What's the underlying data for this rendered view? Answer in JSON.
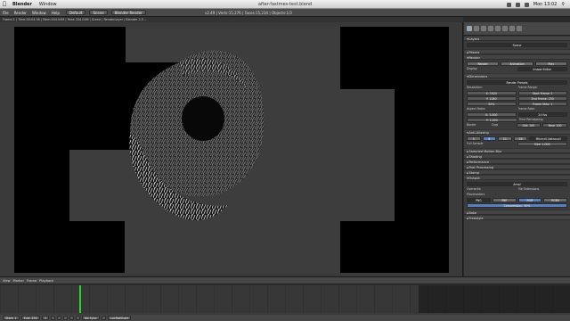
{
  "mac_menu": {
    "apple": "",
    "app": "Blender",
    "items": [
      "Window"
    ],
    "window_title": "after-fastmes-test.blend",
    "clock": "Mon 13:02"
  },
  "blender_header": {
    "menus": [
      "File",
      "Render",
      "Window",
      "Help"
    ],
    "screen_layout": "Default",
    "scene": "Scene",
    "engine": "Blender Render",
    "info": "v2.49 | Verts:15,376 | Faces:15,234 | Objects:1/3"
  },
  "render_info": "Frame:1 | Time:00:04.58 | Mem:204.04M | Peak 204.04M | Scene | RenderLayer | Blender 2.5 ...",
  "properties": {
    "layers_panel": "Layers",
    "layers_value": "Scene",
    "passes_panel": "Passes",
    "render_panel": "Render",
    "render_buttons": [
      "Render",
      "Animation",
      "Play"
    ],
    "display_label": "Display",
    "display_value": "Image Editor",
    "dimensions_panel": "Dimensions",
    "preset": "Render Presets",
    "resolution_label": "Resolution:",
    "frame_range_label": "Frame Range:",
    "res_x": "X: 1920",
    "res_y": "Y: 1080",
    "res_pct": "50%",
    "start_frame": "Start Frame: 1",
    "end_frame": "End Frame: 250",
    "frame_step": "Frame Step: 1",
    "aspect_label": "Aspect Ratio:",
    "frame_rate_label": "Frame Rate:",
    "aspect_x": "X: 1.000",
    "aspect_y": "Y: 1.000",
    "fps": "24 fps",
    "time_remap": "Time Remapping:",
    "border_label": "Border",
    "crop_label": "Crop",
    "old": "Old: 100",
    "new": "New: 100",
    "aa_panel": "Anti-Aliasing",
    "aa_samples": [
      "5",
      "8",
      "11",
      "16"
    ],
    "aa_filter": "Mitchell-Netravali",
    "full_sample": "Full Sample",
    "filter_size": "Size: 1.000",
    "motion_blur": "Sampled Motion Blur",
    "shading_panel": "Shading",
    "performance_panel": "Performance",
    "post_panel": "Post Processing",
    "stamp_panel": "Stamp",
    "output_panel": "Output",
    "output_path": "/tmp/",
    "overwrite": "Overwrite",
    "placeholders": "Placeholders",
    "file_ext": "File Extensions",
    "format_buttons": [
      "PNG",
      "BW",
      "RGB",
      "RGBA"
    ],
    "compression": "Compression: 90%",
    "bake_panel": "Bake",
    "freestyle_panel": "Freestyle"
  },
  "timeline": {
    "menus": [
      "View",
      "Marker",
      "Frame",
      "Playback"
    ],
    "start": "Start: 1",
    "end": "End: 250",
    "current": "1",
    "sync": "No Sync",
    "keying": "LocRotScale"
  },
  "colors": {
    "accent": "#5880c0",
    "current_frame": "#33cc33"
  }
}
